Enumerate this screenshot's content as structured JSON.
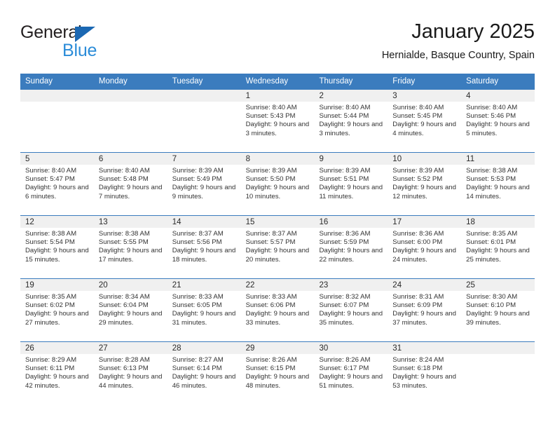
{
  "logo": {
    "word1": "General",
    "word2": "Blue",
    "triangle_color": "#1b68b3",
    "blue_color": "#2b8cd8"
  },
  "header": {
    "title": "January 2025",
    "location": "Hernialde, Basque Country, Spain"
  },
  "theme": {
    "header_blue": "#3b7cbe",
    "day_strip_gray": "#f0f0f0"
  },
  "weekdays": [
    "Sunday",
    "Monday",
    "Tuesday",
    "Wednesday",
    "Thursday",
    "Friday",
    "Saturday"
  ],
  "weeks": [
    [
      {
        "day": "",
        "empty": true
      },
      {
        "day": "",
        "empty": true
      },
      {
        "day": "",
        "empty": true
      },
      {
        "day": "1",
        "sunrise": "Sunrise: 8:40 AM",
        "sunset": "Sunset: 5:43 PM",
        "daylight": "Daylight: 9 hours and 3 minutes."
      },
      {
        "day": "2",
        "sunrise": "Sunrise: 8:40 AM",
        "sunset": "Sunset: 5:44 PM",
        "daylight": "Daylight: 9 hours and 3 minutes."
      },
      {
        "day": "3",
        "sunrise": "Sunrise: 8:40 AM",
        "sunset": "Sunset: 5:45 PM",
        "daylight": "Daylight: 9 hours and 4 minutes."
      },
      {
        "day": "4",
        "sunrise": "Sunrise: 8:40 AM",
        "sunset": "Sunset: 5:46 PM",
        "daylight": "Daylight: 9 hours and 5 minutes."
      }
    ],
    [
      {
        "day": "5",
        "sunrise": "Sunrise: 8:40 AM",
        "sunset": "Sunset: 5:47 PM",
        "daylight": "Daylight: 9 hours and 6 minutes."
      },
      {
        "day": "6",
        "sunrise": "Sunrise: 8:40 AM",
        "sunset": "Sunset: 5:48 PM",
        "daylight": "Daylight: 9 hours and 7 minutes."
      },
      {
        "day": "7",
        "sunrise": "Sunrise: 8:39 AM",
        "sunset": "Sunset: 5:49 PM",
        "daylight": "Daylight: 9 hours and 9 minutes."
      },
      {
        "day": "8",
        "sunrise": "Sunrise: 8:39 AM",
        "sunset": "Sunset: 5:50 PM",
        "daylight": "Daylight: 9 hours and 10 minutes."
      },
      {
        "day": "9",
        "sunrise": "Sunrise: 8:39 AM",
        "sunset": "Sunset: 5:51 PM",
        "daylight": "Daylight: 9 hours and 11 minutes."
      },
      {
        "day": "10",
        "sunrise": "Sunrise: 8:39 AM",
        "sunset": "Sunset: 5:52 PM",
        "daylight": "Daylight: 9 hours and 12 minutes."
      },
      {
        "day": "11",
        "sunrise": "Sunrise: 8:38 AM",
        "sunset": "Sunset: 5:53 PM",
        "daylight": "Daylight: 9 hours and 14 minutes."
      }
    ],
    [
      {
        "day": "12",
        "sunrise": "Sunrise: 8:38 AM",
        "sunset": "Sunset: 5:54 PM",
        "daylight": "Daylight: 9 hours and 15 minutes."
      },
      {
        "day": "13",
        "sunrise": "Sunrise: 8:38 AM",
        "sunset": "Sunset: 5:55 PM",
        "daylight": "Daylight: 9 hours and 17 minutes."
      },
      {
        "day": "14",
        "sunrise": "Sunrise: 8:37 AM",
        "sunset": "Sunset: 5:56 PM",
        "daylight": "Daylight: 9 hours and 18 minutes."
      },
      {
        "day": "15",
        "sunrise": "Sunrise: 8:37 AM",
        "sunset": "Sunset: 5:57 PM",
        "daylight": "Daylight: 9 hours and 20 minutes."
      },
      {
        "day": "16",
        "sunrise": "Sunrise: 8:36 AM",
        "sunset": "Sunset: 5:59 PM",
        "daylight": "Daylight: 9 hours and 22 minutes."
      },
      {
        "day": "17",
        "sunrise": "Sunrise: 8:36 AM",
        "sunset": "Sunset: 6:00 PM",
        "daylight": "Daylight: 9 hours and 24 minutes."
      },
      {
        "day": "18",
        "sunrise": "Sunrise: 8:35 AM",
        "sunset": "Sunset: 6:01 PM",
        "daylight": "Daylight: 9 hours and 25 minutes."
      }
    ],
    [
      {
        "day": "19",
        "sunrise": "Sunrise: 8:35 AM",
        "sunset": "Sunset: 6:02 PM",
        "daylight": "Daylight: 9 hours and 27 minutes."
      },
      {
        "day": "20",
        "sunrise": "Sunrise: 8:34 AM",
        "sunset": "Sunset: 6:04 PM",
        "daylight": "Daylight: 9 hours and 29 minutes."
      },
      {
        "day": "21",
        "sunrise": "Sunrise: 8:33 AM",
        "sunset": "Sunset: 6:05 PM",
        "daylight": "Daylight: 9 hours and 31 minutes."
      },
      {
        "day": "22",
        "sunrise": "Sunrise: 8:33 AM",
        "sunset": "Sunset: 6:06 PM",
        "daylight": "Daylight: 9 hours and 33 minutes."
      },
      {
        "day": "23",
        "sunrise": "Sunrise: 8:32 AM",
        "sunset": "Sunset: 6:07 PM",
        "daylight": "Daylight: 9 hours and 35 minutes."
      },
      {
        "day": "24",
        "sunrise": "Sunrise: 8:31 AM",
        "sunset": "Sunset: 6:09 PM",
        "daylight": "Daylight: 9 hours and 37 minutes."
      },
      {
        "day": "25",
        "sunrise": "Sunrise: 8:30 AM",
        "sunset": "Sunset: 6:10 PM",
        "daylight": "Daylight: 9 hours and 39 minutes."
      }
    ],
    [
      {
        "day": "26",
        "sunrise": "Sunrise: 8:29 AM",
        "sunset": "Sunset: 6:11 PM",
        "daylight": "Daylight: 9 hours and 42 minutes."
      },
      {
        "day": "27",
        "sunrise": "Sunrise: 8:28 AM",
        "sunset": "Sunset: 6:13 PM",
        "daylight": "Daylight: 9 hours and 44 minutes."
      },
      {
        "day": "28",
        "sunrise": "Sunrise: 8:27 AM",
        "sunset": "Sunset: 6:14 PM",
        "daylight": "Daylight: 9 hours and 46 minutes."
      },
      {
        "day": "29",
        "sunrise": "Sunrise: 8:26 AM",
        "sunset": "Sunset: 6:15 PM",
        "daylight": "Daylight: 9 hours and 48 minutes."
      },
      {
        "day": "30",
        "sunrise": "Sunrise: 8:26 AM",
        "sunset": "Sunset: 6:17 PM",
        "daylight": "Daylight: 9 hours and 51 minutes."
      },
      {
        "day": "31",
        "sunrise": "Sunrise: 8:24 AM",
        "sunset": "Sunset: 6:18 PM",
        "daylight": "Daylight: 9 hours and 53 minutes."
      },
      {
        "day": "",
        "empty": true
      }
    ]
  ]
}
